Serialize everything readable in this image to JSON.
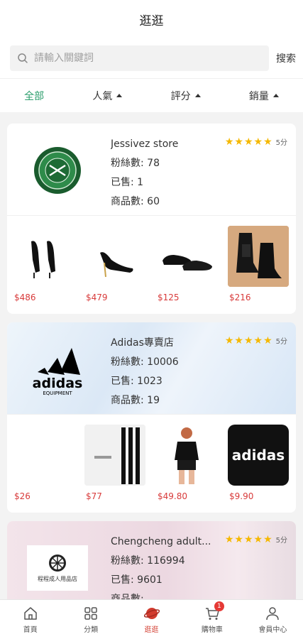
{
  "header": {
    "title": "逛逛"
  },
  "search": {
    "placeholder": "請輸入關鍵詞",
    "button_label": "搜索"
  },
  "filters": [
    {
      "label": "全部",
      "active": true
    },
    {
      "label": "人氣"
    },
    {
      "label": "評分"
    },
    {
      "label": "銷量"
    }
  ],
  "stores": [
    {
      "name": "Jessivez store",
      "fans": "粉絲數: 78",
      "sold": "已售: 1",
      "products_count": "商品數: 60",
      "rating_label": "5分",
      "stars": 5,
      "products": [
        {
          "price": "$486",
          "icon": "black-heel-bow-image"
        },
        {
          "price": "$479",
          "icon": "black-pump-image"
        },
        {
          "price": "$125",
          "icon": "black-flat-shoe-image"
        },
        {
          "price": "$216",
          "icon": "black-boots-image"
        }
      ]
    },
    {
      "name": "Adidas專賣店",
      "fans": "粉絲數: 10006",
      "sold": "已售: 1023",
      "products_count": "商品數: 19",
      "rating_label": "5分",
      "stars": 5,
      "logo_text": "adidas",
      "logo_sub": "EQUIPMENT",
      "products": [
        {
          "price": "$26",
          "icon": "blank-image"
        },
        {
          "price": "$77",
          "icon": "white-stripe-pants-image"
        },
        {
          "price": "$49.80",
          "icon": "black-tshirt-model-image"
        },
        {
          "price": "$9.90",
          "icon": "adidas-logo-image",
          "logo_text": "adidas"
        }
      ]
    },
    {
      "name": "Chengcheng adult...",
      "fans": "粉絲數: 116994",
      "sold": "已售: 9601",
      "products_count": "商品數:",
      "rating_label": "5分",
      "stars": 5,
      "logo_text": "程程成人用品店"
    }
  ],
  "tabbar": [
    {
      "label": "首頁",
      "icon": "home-icon"
    },
    {
      "label": "分類",
      "icon": "category-icon"
    },
    {
      "label": "逛逛",
      "icon": "planet-icon",
      "active": true
    },
    {
      "label": "購物車",
      "icon": "cart-icon",
      "badge": "1"
    },
    {
      "label": "會員中心",
      "icon": "user-icon"
    }
  ],
  "colors": {
    "accent_green": "#2a9d6b",
    "price_red": "#d83a3a",
    "star": "#f5b800",
    "active_tab": "#d23b2e"
  }
}
